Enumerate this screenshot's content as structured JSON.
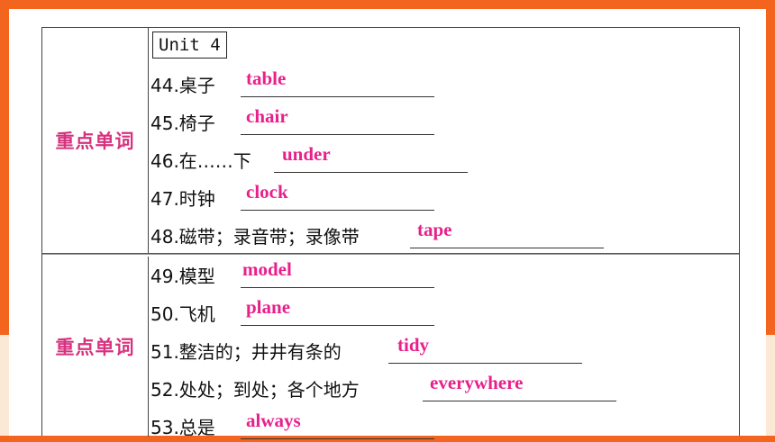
{
  "unit_label": "Unit 4",
  "sections": [
    {
      "category": "重点单词",
      "items": [
        {
          "prompt": "44.桌子",
          "answer": "table"
        },
        {
          "prompt": "45.椅子",
          "answer": "chair"
        },
        {
          "prompt": "46.在……下",
          "answer": "under"
        },
        {
          "prompt": "47.时钟",
          "answer": "clock"
        },
        {
          "prompt": "48.磁带；录音带；录像带",
          "answer": "tape"
        }
      ]
    },
    {
      "category": "重点单词",
      "items": [
        {
          "prompt": "49.模型",
          "answer": "model"
        },
        {
          "prompt": "50.飞机",
          "answer": "plane"
        },
        {
          "prompt": "51.整洁的；井井有条的",
          "answer": "tidy"
        },
        {
          "prompt": "52.处处；到处；各个地方",
          "answer": "everywhere"
        },
        {
          "prompt": "53.总是",
          "answer": "always"
        }
      ]
    }
  ],
  "colors": {
    "accent_orange": "#f3641f",
    "answer_pink": "#e8208c",
    "label_pink": "#d6337f"
  }
}
